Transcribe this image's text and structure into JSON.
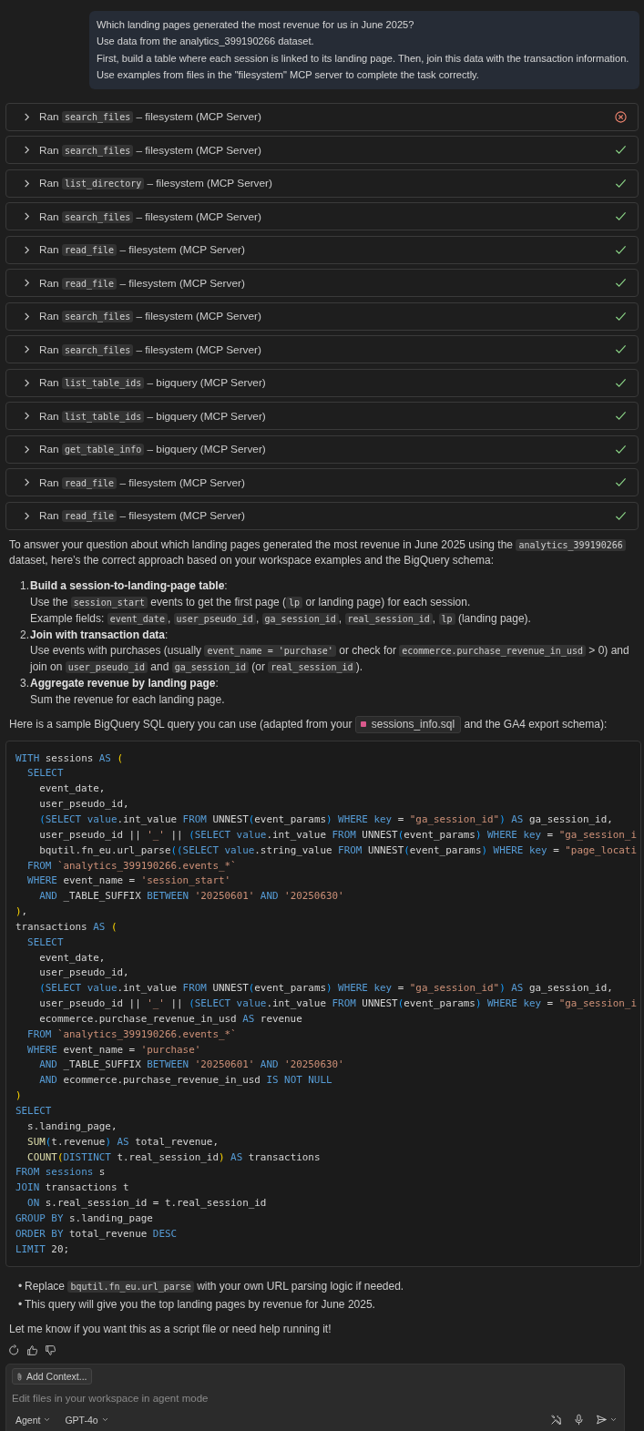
{
  "user_message": {
    "lines": [
      "Which landing pages generated the most revenue for us in June 2025?",
      "Use data from the analytics_399190266 dataset.",
      "First, build a table where each session is linked to its landing page. Then, join this data with the transaction information.",
      "Use examples from files in the \"filesystem\" MCP server to complete the task correctly."
    ]
  },
  "tool_calls": [
    {
      "verb": "Ran",
      "tool": "search_files",
      "source": "– filesystem (MCP Server)",
      "failed": true
    },
    {
      "verb": "Ran",
      "tool": "search_files",
      "source": "– filesystem (MCP Server)",
      "failed": false
    },
    {
      "verb": "Ran",
      "tool": "list_directory",
      "source": "– filesystem (MCP Server)",
      "failed": false
    },
    {
      "verb": "Ran",
      "tool": "search_files",
      "source": "– filesystem (MCP Server)",
      "failed": false
    },
    {
      "verb": "Ran",
      "tool": "read_file",
      "source": "– filesystem (MCP Server)",
      "failed": false
    },
    {
      "verb": "Ran",
      "tool": "read_file",
      "source": "– filesystem (MCP Server)",
      "failed": false
    },
    {
      "verb": "Ran",
      "tool": "search_files",
      "source": "– filesystem (MCP Server)",
      "failed": false
    },
    {
      "verb": "Ran",
      "tool": "search_files",
      "source": "– filesystem (MCP Server)",
      "failed": false
    },
    {
      "verb": "Ran",
      "tool": "list_table_ids",
      "source": "– bigquery (MCP Server)",
      "failed": false
    },
    {
      "verb": "Ran",
      "tool": "list_table_ids",
      "source": "– bigquery (MCP Server)",
      "failed": false
    },
    {
      "verb": "Ran",
      "tool": "get_table_info",
      "source": "– bigquery (MCP Server)",
      "failed": false
    },
    {
      "verb": "Ran",
      "tool": "read_file",
      "source": "– filesystem (MCP Server)",
      "failed": false
    },
    {
      "verb": "Ran",
      "tool": "read_file",
      "source": "– filesystem (MCP Server)",
      "failed": false
    }
  ],
  "answer": {
    "intro": [
      {
        "text": "To answer your question about which landing pages generated the most revenue in June 2025 using the ",
        "kind": "text"
      },
      {
        "text": "analytics_399190266",
        "kind": "code"
      },
      {
        "text": " dataset, here’s the correct approach based on your workspace examples and the BigQuery schema:",
        "kind": "text"
      }
    ],
    "steps": [
      {
        "number": "1.",
        "title": [
          {
            "text": "Build a session-to-landing-page table",
            "kind": "bold"
          },
          {
            "text": ":",
            "kind": "text"
          }
        ],
        "details": [
          [
            {
              "text": "Use the ",
              "kind": "text"
            },
            {
              "text": "session_start",
              "kind": "code"
            },
            {
              "text": " events to get the first page (",
              "kind": "text"
            },
            {
              "text": "lp",
              "kind": "code"
            },
            {
              "text": " or landing page) for each session.",
              "kind": "text"
            }
          ],
          [
            {
              "text": "Example fields: ",
              "kind": "text"
            },
            {
              "text": "event_date",
              "kind": "code"
            },
            {
              "text": ", ",
              "kind": "text"
            },
            {
              "text": "user_pseudo_id",
              "kind": "code"
            },
            {
              "text": ", ",
              "kind": "text"
            },
            {
              "text": "ga_session_id",
              "kind": "code"
            },
            {
              "text": ", ",
              "kind": "text"
            },
            {
              "text": "real_session_id",
              "kind": "code"
            },
            {
              "text": ", ",
              "kind": "text"
            },
            {
              "text": "lp",
              "kind": "code"
            },
            {
              "text": " (landing page).",
              "kind": "text"
            }
          ]
        ]
      },
      {
        "number": "2.",
        "title": [
          {
            "text": "Join with transaction data",
            "kind": "bold"
          },
          {
            "text": ":",
            "kind": "text"
          }
        ],
        "details": [
          [
            {
              "text": "Use events with purchases (usually ",
              "kind": "text"
            },
            {
              "text": "event_name = 'purchase'",
              "kind": "code"
            },
            {
              "text": " or check for ",
              "kind": "text"
            },
            {
              "text": "ecommerce.purchase_revenue_in_usd",
              "kind": "code"
            },
            {
              "text": " > 0) and join on ",
              "kind": "text"
            },
            {
              "text": "user_pseudo_id",
              "kind": "code"
            },
            {
              "text": " and ",
              "kind": "text"
            },
            {
              "text": "ga_session_id",
              "kind": "code"
            },
            {
              "text": " (or ",
              "kind": "text"
            },
            {
              "text": "real_session_id",
              "kind": "code"
            },
            {
              "text": ").",
              "kind": "text"
            }
          ]
        ]
      },
      {
        "number": "3.",
        "title": [
          {
            "text": "Aggregate revenue by landing page",
            "kind": "bold"
          },
          {
            "text": ":",
            "kind": "text"
          }
        ],
        "details": [
          [
            {
              "text": "Sum the revenue for each landing page.",
              "kind": "text"
            }
          ]
        ]
      }
    ],
    "sample_intro": [
      {
        "text": "Here is a sample BigQuery SQL query you can use (adapted from your ",
        "kind": "text"
      },
      {
        "text": "sessions_info.sql",
        "kind": "file"
      },
      {
        "text": " and the GA4 export schema):",
        "kind": "text"
      }
    ],
    "code_lines": [
      [
        {
          "text": "WITH",
          "kind": "keyword"
        },
        {
          "text": " sessions ",
          "kind": "plain"
        },
        {
          "text": "AS",
          "kind": "keyword"
        },
        {
          "text": " (",
          "kind": "bracket"
        }
      ],
      [
        {
          "text": "  SELECT",
          "kind": "keyword"
        }
      ],
      [
        {
          "text": "    event_date,",
          "kind": "plain"
        }
      ],
      [
        {
          "text": "    user_pseudo_id,",
          "kind": "plain"
        }
      ],
      [
        {
          "text": "    (",
          "kind": "bracket2"
        },
        {
          "text": "SELECT",
          "kind": "keyword"
        },
        {
          "text": " value",
          "kind": "keyword"
        },
        {
          "text": ".int_value ",
          "kind": "plain"
        },
        {
          "text": "FROM",
          "kind": "keyword"
        },
        {
          "text": " UNNEST",
          "kind": "plain"
        },
        {
          "text": "(",
          "kind": "bracket2"
        },
        {
          "text": "event_params",
          "kind": "plain"
        },
        {
          "text": ")",
          "kind": "bracket2"
        },
        {
          "text": " WHERE",
          "kind": "keyword"
        },
        {
          "text": " key",
          "kind": "keyword"
        },
        {
          "text": " = ",
          "kind": "plain"
        },
        {
          "text": "\"ga_session_id\"",
          "kind": "string"
        },
        {
          "text": ")",
          "kind": "bracket2"
        },
        {
          "text": " AS",
          "kind": "keyword"
        },
        {
          "text": " ga_session_id,",
          "kind": "plain"
        }
      ],
      [
        {
          "text": "    user_pseudo_id || ",
          "kind": "plain"
        },
        {
          "text": "'_'",
          "kind": "string"
        },
        {
          "text": " || ",
          "kind": "plain"
        },
        {
          "text": "(",
          "kind": "bracket2"
        },
        {
          "text": "SELECT",
          "kind": "keyword"
        },
        {
          "text": " value",
          "kind": "keyword"
        },
        {
          "text": ".int_value ",
          "kind": "plain"
        },
        {
          "text": "FROM",
          "kind": "keyword"
        },
        {
          "text": " UNNEST",
          "kind": "plain"
        },
        {
          "text": "(",
          "kind": "bracket2"
        },
        {
          "text": "event_params",
          "kind": "plain"
        },
        {
          "text": ")",
          "kind": "bracket2"
        },
        {
          "text": " WHERE",
          "kind": "keyword"
        },
        {
          "text": " key",
          "kind": "keyword"
        },
        {
          "text": " = ",
          "kind": "plain"
        },
        {
          "text": "\"ga_session_i",
          "kind": "string"
        }
      ],
      [
        {
          "text": "    bqutil.fn_eu.url_parse",
          "kind": "plain"
        },
        {
          "text": "((",
          "kind": "bracket2"
        },
        {
          "text": "SELECT",
          "kind": "keyword"
        },
        {
          "text": " value",
          "kind": "keyword"
        },
        {
          "text": ".string_value ",
          "kind": "plain"
        },
        {
          "text": "FROM",
          "kind": "keyword"
        },
        {
          "text": " UNNEST",
          "kind": "plain"
        },
        {
          "text": "(",
          "kind": "bracket2"
        },
        {
          "text": "event_params",
          "kind": "plain"
        },
        {
          "text": ")",
          "kind": "bracket2"
        },
        {
          "text": " WHERE",
          "kind": "keyword"
        },
        {
          "text": " key",
          "kind": "keyword"
        },
        {
          "text": " = ",
          "kind": "plain"
        },
        {
          "text": "\"page_locati",
          "kind": "string"
        }
      ],
      [
        {
          "text": "  FROM",
          "kind": "keyword"
        },
        {
          "text": " `analytics_399190266.events_*`",
          "kind": "string"
        }
      ],
      [
        {
          "text": "  WHERE",
          "kind": "keyword"
        },
        {
          "text": " event_name = ",
          "kind": "plain"
        },
        {
          "text": "'session_start'",
          "kind": "string"
        }
      ],
      [
        {
          "text": "    AND",
          "kind": "keyword"
        },
        {
          "text": " _TABLE_SUFFIX ",
          "kind": "plain"
        },
        {
          "text": "BETWEEN",
          "kind": "keyword"
        },
        {
          "text": " '20250601'",
          "kind": "string"
        },
        {
          "text": " AND",
          "kind": "keyword"
        },
        {
          "text": " '20250630'",
          "kind": "string"
        }
      ],
      [
        {
          "text": ")",
          "kind": "bracket"
        },
        {
          "text": ",",
          "kind": "plain"
        }
      ],
      [
        {
          "text": "transactions ",
          "kind": "plain"
        },
        {
          "text": "AS",
          "kind": "keyword"
        },
        {
          "text": " (",
          "kind": "bracket"
        }
      ],
      [
        {
          "text": "  SELECT",
          "kind": "keyword"
        }
      ],
      [
        {
          "text": "    event_date,",
          "kind": "plain"
        }
      ],
      [
        {
          "text": "    user_pseudo_id,",
          "kind": "plain"
        }
      ],
      [
        {
          "text": "    (",
          "kind": "bracket2"
        },
        {
          "text": "SELECT",
          "kind": "keyword"
        },
        {
          "text": " value",
          "kind": "keyword"
        },
        {
          "text": ".int_value ",
          "kind": "plain"
        },
        {
          "text": "FROM",
          "kind": "keyword"
        },
        {
          "text": " UNNEST",
          "kind": "plain"
        },
        {
          "text": "(",
          "kind": "bracket2"
        },
        {
          "text": "event_params",
          "kind": "plain"
        },
        {
          "text": ")",
          "kind": "bracket2"
        },
        {
          "text": " WHERE",
          "kind": "keyword"
        },
        {
          "text": " key",
          "kind": "keyword"
        },
        {
          "text": " = ",
          "kind": "plain"
        },
        {
          "text": "\"ga_session_id\"",
          "kind": "string"
        },
        {
          "text": ")",
          "kind": "bracket2"
        },
        {
          "text": " AS",
          "kind": "keyword"
        },
        {
          "text": " ga_session_id,",
          "kind": "plain"
        }
      ],
      [
        {
          "text": "    user_pseudo_id || ",
          "kind": "plain"
        },
        {
          "text": "'_'",
          "kind": "string"
        },
        {
          "text": " || ",
          "kind": "plain"
        },
        {
          "text": "(",
          "kind": "bracket2"
        },
        {
          "text": "SELECT",
          "kind": "keyword"
        },
        {
          "text": " value",
          "kind": "keyword"
        },
        {
          "text": ".int_value ",
          "kind": "plain"
        },
        {
          "text": "FROM",
          "kind": "keyword"
        },
        {
          "text": " UNNEST",
          "kind": "plain"
        },
        {
          "text": "(",
          "kind": "bracket2"
        },
        {
          "text": "event_params",
          "kind": "plain"
        },
        {
          "text": ")",
          "kind": "bracket2"
        },
        {
          "text": " WHERE",
          "kind": "keyword"
        },
        {
          "text": " key",
          "kind": "keyword"
        },
        {
          "text": " = ",
          "kind": "plain"
        },
        {
          "text": "\"ga_session_i",
          "kind": "string"
        }
      ],
      [
        {
          "text": "    ecommerce.purchase_revenue_in_usd ",
          "kind": "plain"
        },
        {
          "text": "AS",
          "kind": "keyword"
        },
        {
          "text": " revenue",
          "kind": "plain"
        }
      ],
      [
        {
          "text": "  FROM",
          "kind": "keyword"
        },
        {
          "text": " `analytics_399190266.events_*`",
          "kind": "string"
        }
      ],
      [
        {
          "text": "  WHERE",
          "kind": "keyword"
        },
        {
          "text": " event_name = ",
          "kind": "plain"
        },
        {
          "text": "'purchase'",
          "kind": "string"
        }
      ],
      [
        {
          "text": "    AND",
          "kind": "keyword"
        },
        {
          "text": " _TABLE_SUFFIX ",
          "kind": "plain"
        },
        {
          "text": "BETWEEN",
          "kind": "keyword"
        },
        {
          "text": " '20250601'",
          "kind": "string"
        },
        {
          "text": " AND",
          "kind": "keyword"
        },
        {
          "text": " '20250630'",
          "kind": "string"
        }
      ],
      [
        {
          "text": "    AND",
          "kind": "keyword"
        },
        {
          "text": " ecommerce.purchase_revenue_in_usd ",
          "kind": "plain"
        },
        {
          "text": "IS NOT NULL",
          "kind": "keyword"
        }
      ],
      [
        {
          "text": ")",
          "kind": "bracket"
        }
      ],
      [
        {
          "text": "SELECT",
          "kind": "keyword"
        }
      ],
      [
        {
          "text": "  s.landing_page,",
          "kind": "plain"
        }
      ],
      [
        {
          "text": "  SUM",
          "kind": "function"
        },
        {
          "text": "(",
          "kind": "bracket2"
        },
        {
          "text": "t.revenue",
          "kind": "plain"
        },
        {
          "text": ")",
          "kind": "bracket2"
        },
        {
          "text": " AS",
          "kind": "keyword"
        },
        {
          "text": " total_revenue,",
          "kind": "plain"
        }
      ],
      [
        {
          "text": "  COUNT",
          "kind": "function"
        },
        {
          "text": "(",
          "kind": "bracket"
        },
        {
          "text": "DISTINCT",
          "kind": "keyword"
        },
        {
          "text": " t.real_session_id",
          "kind": "plain"
        },
        {
          "text": ")",
          "kind": "bracket"
        },
        {
          "text": " AS",
          "kind": "keyword"
        },
        {
          "text": " transactions",
          "kind": "plain"
        }
      ],
      [
        {
          "text": "FROM",
          "kind": "keyword"
        },
        {
          "text": " sessions",
          "kind": "keyword"
        },
        {
          "text": " s",
          "kind": "plain"
        }
      ],
      [
        {
          "text": "JOIN",
          "kind": "keyword"
        },
        {
          "text": " transactions t",
          "kind": "plain"
        }
      ],
      [
        {
          "text": "  ON",
          "kind": "keyword"
        },
        {
          "text": " s.real_session_id = t.real_session_id",
          "kind": "plain"
        }
      ],
      [
        {
          "text": "GROUP BY",
          "kind": "keyword"
        },
        {
          "text": " s.landing_page",
          "kind": "plain"
        }
      ],
      [
        {
          "text": "ORDER BY",
          "kind": "keyword"
        },
        {
          "text": " total_revenue ",
          "kind": "plain"
        },
        {
          "text": "DESC",
          "kind": "keyword"
        }
      ],
      [
        {
          "text": "LIMIT",
          "kind": "keyword"
        },
        {
          "text": " 20;",
          "kind": "plain"
        }
      ]
    ],
    "bullets": [
      {
        "bullet": "•",
        "text": [
          {
            "text": "Replace ",
            "kind": "text"
          },
          {
            "text": "bqutil.fn_eu.url_parse",
            "kind": "code"
          },
          {
            "text": " with your own URL parsing logic if needed.",
            "kind": "text"
          }
        ]
      },
      {
        "bullet": "•",
        "text": [
          {
            "text": "This query will give you the top landing pages by revenue for June 2025.",
            "kind": "text"
          }
        ]
      }
    ],
    "closing": "Let me know if you want this as a script file or need help running it!"
  },
  "chat_input": {
    "add_context": "Add Context...",
    "placeholder": "Edit files in your workspace in agent mode",
    "mode": "Agent",
    "model": "GPT-4o"
  }
}
